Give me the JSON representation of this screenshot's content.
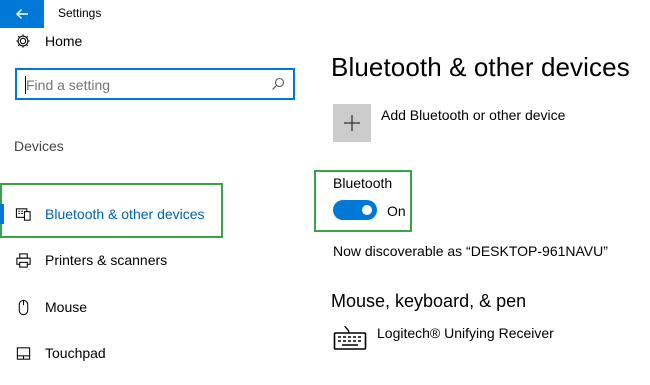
{
  "window": {
    "title": "Settings"
  },
  "sidebar": {
    "home_label": "Home",
    "search_placeholder": "Find a setting",
    "group_header": "Devices",
    "items": [
      {
        "label": "Bluetooth & other devices",
        "icon": "bluetooth-devices-icon",
        "active": true
      },
      {
        "label": "Printers & scanners",
        "icon": "printer-icon",
        "active": false
      },
      {
        "label": "Mouse",
        "icon": "mouse-icon",
        "active": false
      },
      {
        "label": "Touchpad",
        "icon": "touchpad-icon",
        "active": false
      }
    ]
  },
  "main": {
    "title": "Bluetooth & other devices",
    "add_label": "Add Bluetooth or other device",
    "bluetooth": {
      "label": "Bluetooth",
      "state_label": "On",
      "enabled": true
    },
    "discoverable_text": "Now discoverable as “DESKTOP-961NAVU”",
    "section_header": "Mouse, keyboard, & pen",
    "devices": [
      {
        "label": "Logitech® Unifying Receiver",
        "icon": "keyboard-icon"
      }
    ]
  },
  "colors": {
    "accent": "#0078d7",
    "highlight_box": "#3aa34a",
    "add_tile": "#cccccc"
  }
}
